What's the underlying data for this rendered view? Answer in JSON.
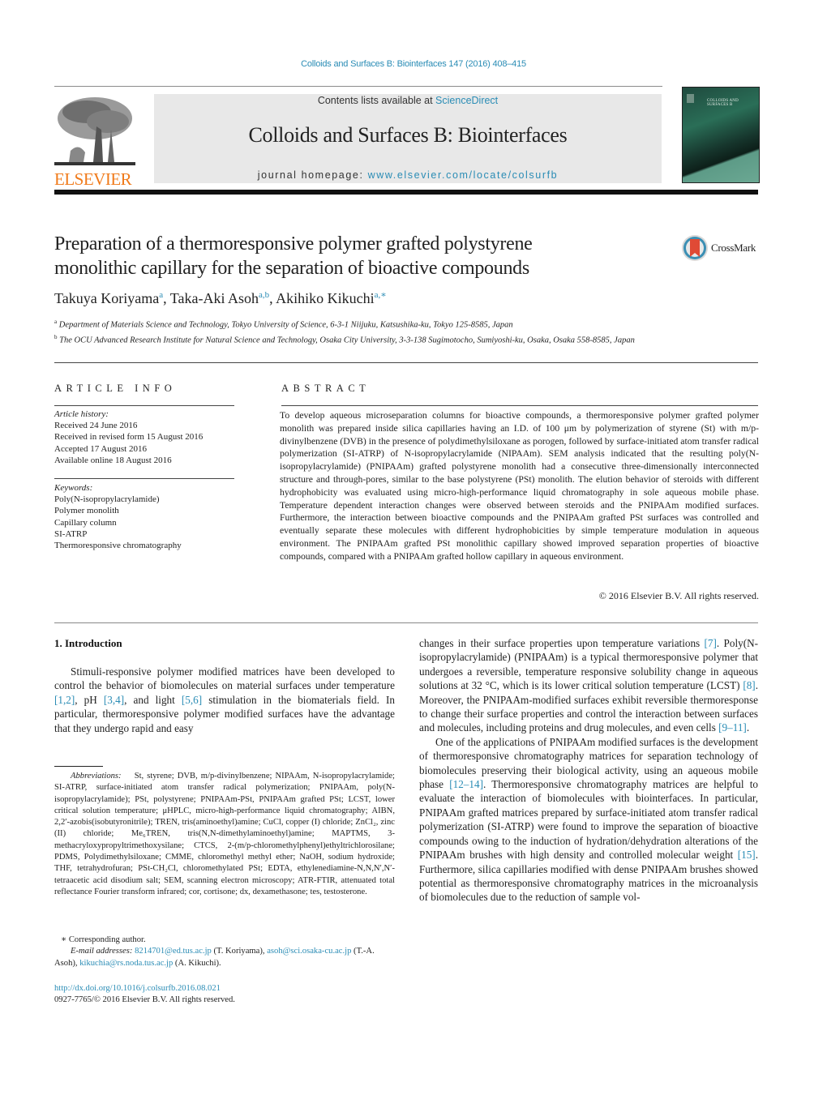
{
  "journal_ref": "Colloids and Surfaces B: Biointerfaces 147 (2016) 408–415",
  "header": {
    "contents_prefix": "Contents lists available at ",
    "contents_link": "ScienceDirect",
    "journal_title": "Colloids and Surfaces B: Biointerfaces",
    "homepage_prefix": "journal homepage: ",
    "homepage_link": "www.elsevier.com/locate/colsurfb",
    "publisher_logo_text": "ELSEVIER",
    "cover_title": "COLLOIDS AND SURFACES B",
    "publisher_color": "#f07a1a",
    "link_color": "#2a8cb5"
  },
  "paper": {
    "title_line1": "Preparation of a thermoresponsive polymer grafted polystyrene",
    "title_line2": "monolithic capillary for the separation of bioactive compounds",
    "crossmark_label": "CrossMark",
    "authors": [
      {
        "name": "Takuya Koriyama",
        "aff": "a",
        "sep": ", "
      },
      {
        "name": "Taka-Aki Asoh",
        "aff": "a,b",
        "sep": ", "
      },
      {
        "name": "Akihiko Kikuchi",
        "aff": "a,∗",
        "sep": ""
      }
    ],
    "affiliations": [
      {
        "mark": "a",
        "text": "Department of Materials Science and Technology, Tokyo University of Science, 6-3-1 Niijuku, Katsushika-ku, Tokyo 125-8585, Japan"
      },
      {
        "mark": "b",
        "text": "The OCU Advanced Research Institute for Natural Science and Technology, Osaka City University, 3-3-138 Sugimotocho, Sumiyoshi-ku, Osaka, Osaka 558-8585, Japan"
      }
    ]
  },
  "article_info": {
    "heading": "ARTICLE INFO",
    "history_label": "Article history:",
    "history": [
      "Received 24 June 2016",
      "Received in revised form 15 August 2016",
      "Accepted 17 August 2016",
      "Available online 18 August 2016"
    ],
    "keywords_label": "Keywords:",
    "keywords": [
      "Poly(N-isopropylacrylamide)",
      "Polymer monolith",
      "Capillary column",
      "SI-ATRP",
      "Thermoresponsive chromatography"
    ]
  },
  "abstract": {
    "heading": "ABSTRACT",
    "text": "To develop aqueous microseparation columns for bioactive compounds, a thermoresponsive polymer grafted polymer monolith was prepared inside silica capillaries having an I.D. of 100 μm by polymerization of styrene (St) with m/p-divinylbenzene (DVB) in the presence of polydimethylsiloxane as porogen, followed by surface-initiated atom transfer radical polymerization (SI-ATRP) of N-isopropylacrylamide (NIPAAm). SEM analysis indicated that the resulting poly(N-isopropylacrylamide) (PNIPAAm) grafted polystyrene monolith had a consecutive three-dimensionally interconnected structure and through-pores, similar to the base polystyrene (PSt) monolith. The elution behavior of steroids with different hydrophobicity was evaluated using micro-high-performance liquid chromatography in sole aqueous mobile phase. Temperature dependent interaction changes were observed between steroids and the PNIPAAm modified surfaces. Furthermore, the interaction between bioactive compounds and the PNIPAAm grafted PSt surfaces was controlled and eventually separate these molecules with different hydrophobicities by simple temperature modulation in aqueous environment. The PNIPAAm grafted PSt monolithic capillary showed improved separation properties of bioactive compounds, compared with a PNIPAAm grafted hollow capillary in aqueous environment.",
    "copyright": "© 2016 Elsevier B.V. All rights reserved."
  },
  "body": {
    "intro_heading": "1.  Introduction",
    "left_para": [
      {
        "t": "Stimuli-responsive polymer modified matrices have been developed to control the behavior of biomolecules on material surfaces under temperature "
      },
      {
        "ref": "[1,2]"
      },
      {
        "t": ", pH "
      },
      {
        "ref": "[3,4]"
      },
      {
        "t": ", and light "
      },
      {
        "ref": "[5,6]"
      },
      {
        "t": " stimulation in the biomaterials field. In particular, thermoresponsive polymer modified surfaces have the advantage that they undergo rapid and easy"
      }
    ],
    "right_para1": [
      {
        "t": "changes in their surface properties upon temperature variations "
      },
      {
        "ref": "[7]"
      },
      {
        "t": ". Poly(N-isopropylacrylamide) (PNIPAAm) is a typical thermoresponsive polymer that undergoes a reversible, temperature responsive solubility change in aqueous solutions at 32 °C, which is its lower critical solution temperature (LCST) "
      },
      {
        "ref": "[8]"
      },
      {
        "t": ". Moreover, the PNIPAAm-modified surfaces exhibit reversible thermoresponse to change their surface properties and control the interaction between surfaces and molecules, including proteins and drug molecules, and even cells "
      },
      {
        "ref": "[9–11]"
      },
      {
        "t": "."
      }
    ],
    "right_para2": [
      {
        "t": "One of the applications of PNIPAAm modified surfaces is the development of thermoresponsive chromatography matrices for separation technology of biomolecules preserving their biological activity, using an aqueous mobile phase "
      },
      {
        "ref": "[12–14]"
      },
      {
        "t": ". Thermoresponsive chromatography matrices are helpful to evaluate the interaction of biomolecules with biointerfaces. In particular, PNIPAAm grafted matrices prepared by surface-initiated atom transfer radical polymerization (SI-ATRP) were found to improve the separation of bioactive compounds owing to the induction of hydration/dehydration alterations of the PNIPAAm brushes with high density and controlled molecular weight "
      },
      {
        "ref": "[15]"
      },
      {
        "t": ". Furthermore, silica capillaries modified with dense PNIPAAm brushes showed potential as thermoresponsive chromatography matrices in the microanalysis of biomolecules due to the reduction of sample vol-"
      }
    ]
  },
  "footnotes": {
    "abbreviations_label": "Abbreviations:",
    "abbreviations": "St, styrene; DVB, m/p-divinylbenzene; NIPAAm, N-isopropylacrylamide; SI-ATRP, surface-initiated atom transfer radical polymerization; PNIPAAm, poly(N-isopropylacrylamide); PSt, polystyrene; PNIPAAm-PSt, PNIPAAm grafted PSt; LCST, lower critical solution temperature; μHPLC, micro-high-performance liquid chromatography; AIBN, 2,2′-azobis(isobutyronitrile); TREN, tris(aminoethyl)amine; CuCl, copper (I) chloride; ZnCl₂, zinc (II) chloride; Me₆TREN, tris(N,N-dimethylaminoethyl)amine; MAPTMS, 3-methacryloxypropyltrimethoxysilane; CTCS, 2-(m/p-chloromethylphenyl)ethyltrichlorosilane; PDMS, Polydimethylsiloxane; CMME, chloromethyl methyl ether; NaOH, sodium hydroxide; THF, tetrahydrofuran; PSt-CH₂Cl, chloromethylated PSt; EDTA, ethylenediamine-N,N,N′,N′-tetraacetic acid disodium salt; SEM, scanning electron microscopy; ATR-FTIR, attenuated total reflectance Fourier transform infrared; cor, cortisone; dx, dexamethasone; tes, testosterone.",
    "corresponding": "∗  Corresponding author.",
    "email_label": "E-mail addresses: ",
    "emails": [
      {
        "addr": "8214701@ed.tus.ac.jp",
        "who": " (T. Koriyama), "
      },
      {
        "addr": "asoh@sci.osaka-cu.ac.jp",
        "who": " (T.-A. Asoh), "
      },
      {
        "addr": "kikuchia@rs.noda.tus.ac.jp",
        "who": " (A. Kikuchi)."
      }
    ],
    "doi": "http://dx.doi.org/10.1016/j.colsurfb.2016.08.021",
    "issn_line": "0927-7765/© 2016 Elsevier B.V. All rights reserved."
  }
}
